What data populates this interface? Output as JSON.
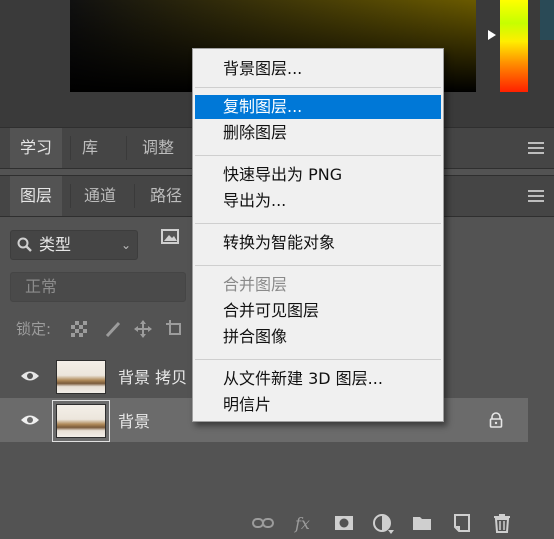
{
  "top_panel": {
    "tabs": [
      {
        "label": "学习"
      },
      {
        "label": "库"
      },
      {
        "label": "调整"
      }
    ]
  },
  "layers_panel": {
    "tabs": [
      {
        "label": "图层"
      },
      {
        "label": "通道"
      },
      {
        "label": "路径"
      }
    ],
    "filter_kind": "类型",
    "blend_mode": "正常",
    "lock_label": "锁定:",
    "layers": [
      {
        "name": "背景 拷贝",
        "selected": false
      },
      {
        "name": "背景",
        "selected": true
      }
    ]
  },
  "context_menu": {
    "items": [
      {
        "label": "背景图层..."
      },
      {
        "label": "复制图层..."
      },
      {
        "label": "删除图层"
      },
      {
        "label": "快速导出为 PNG"
      },
      {
        "label": "导出为..."
      },
      {
        "label": "转换为智能对象"
      },
      {
        "label": "合并图层"
      },
      {
        "label": "合并可见图层"
      },
      {
        "label": "拼合图像"
      },
      {
        "label": "从文件新建 3D 图层..."
      },
      {
        "label": "明信片"
      }
    ],
    "highlighted": "复制图层...",
    "disabled": [
      "合并图层"
    ]
  },
  "colors": {
    "panel_bg": "#535353",
    "menu_bg": "#f0f0f0",
    "menu_highlight": "#0078d7",
    "selected_layer_bg": "#6b6b6b"
  }
}
